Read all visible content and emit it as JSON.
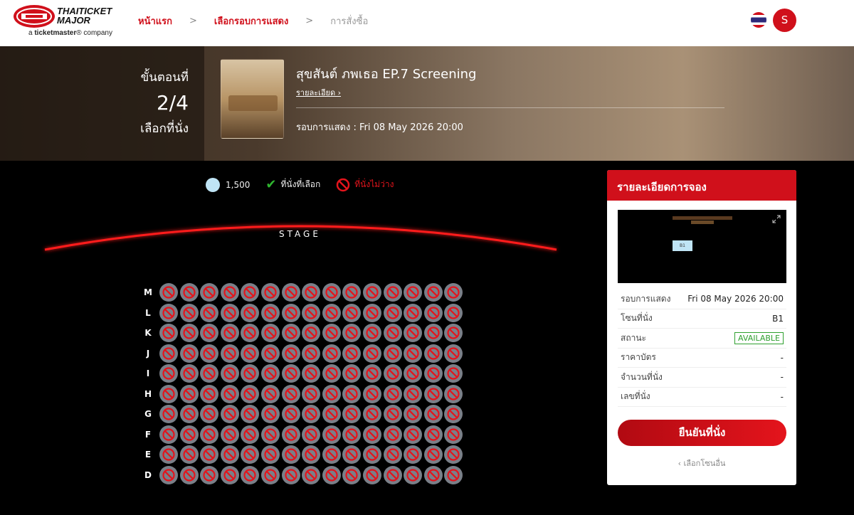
{
  "header": {
    "logo_line1": "THAITICKET",
    "logo_line2": "MAJOR",
    "logo_sub_prefix": "a ",
    "logo_sub_brand": "ticketmaster",
    "logo_sub_suffix": "® company",
    "crumbs": [
      "หน้าแรก",
      "เลือกรอบการแสดง",
      "การสั่งซื้อ"
    ],
    "crumb_sep": ">",
    "avatar_letter": "S"
  },
  "banner": {
    "step_label": "ขั้นตอนที่",
    "step_value": "2/4",
    "step_name": "เลือกที่นั่ง",
    "title": "สุขสันต์ ภพเธอ EP.7 Screening",
    "detail_link": "รายละเอียด ›",
    "round_label": "รอบการแสดง",
    "round_value": ": Fri 08 May 2026 20:00"
  },
  "legend": {
    "price": "1,500",
    "selected": "ที่นั่งที่เลือก",
    "unavailable": "ที่นั่งไม่ว่าง"
  },
  "stage": {
    "label": "STAGE"
  },
  "seatmap": {
    "rows": [
      "M",
      "L",
      "K",
      "J",
      "I",
      "H",
      "G",
      "F",
      "E",
      "D"
    ],
    "seats_per_row": 15,
    "seat_status": "unavailable"
  },
  "panel": {
    "title": "รายละเอียดการจอง",
    "minimap_seat": "B1",
    "rows": [
      {
        "k": "รอบการแสดง",
        "v": "Fri 08 May 2026 20:00"
      },
      {
        "k": "โซนที่นั่ง",
        "v": "B1"
      },
      {
        "k": "สถานะ",
        "v": "AVAILABLE"
      },
      {
        "k": "ราคาบัตร",
        "v": "-"
      },
      {
        "k": "จำนวนที่นั่ง",
        "v": "-"
      },
      {
        "k": "เลขที่นั่ง",
        "v": "-"
      }
    ],
    "confirm_label": "ยืนยันที่นั่ง",
    "other_zone": "‹ เลือกโซนอื่น"
  },
  "colors": {
    "brand_red": "#d0101b",
    "seat_gray": "#7a7f88",
    "available_blue": "#bfe4f5",
    "status_green": "#2fa02f"
  }
}
